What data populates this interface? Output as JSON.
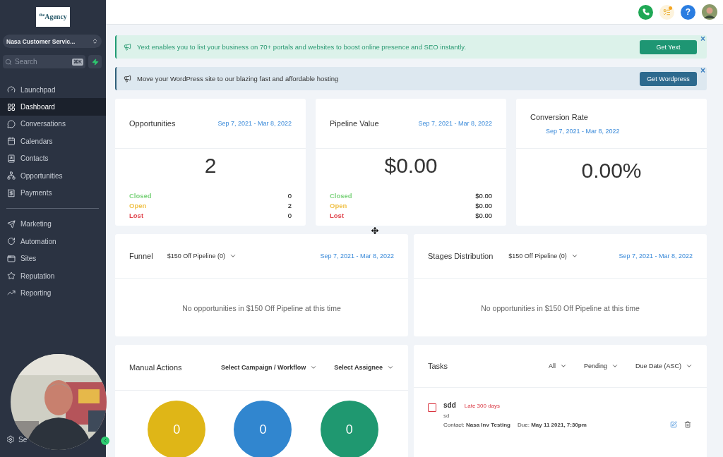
{
  "sidebar": {
    "logo": "$^{the}$Agency",
    "account": "Nasa Customer Servic...",
    "search": {
      "placeholder": "Search",
      "shortcut": "⌘K"
    },
    "nav_groups": [
      [
        {
          "label": "Launchpad",
          "selected": false
        },
        {
          "label": "Dashboard",
          "selected": true
        },
        {
          "label": "Conversations",
          "selected": false
        },
        {
          "label": "Calendars",
          "selected": false
        },
        {
          "label": "Contacts",
          "selected": false
        },
        {
          "label": "Opportunities",
          "selected": false
        },
        {
          "label": "Payments",
          "selected": false
        }
      ],
      [
        {
          "label": "Marketing",
          "selected": false
        },
        {
          "label": "Automation",
          "selected": false
        },
        {
          "label": "Sites",
          "selected": false
        },
        {
          "label": "Reputation",
          "selected": false
        },
        {
          "label": "Reporting",
          "selected": false
        }
      ]
    ],
    "settings": "Se"
  },
  "topbar": {
    "help": "?",
    "notification_dot": true
  },
  "banners": [
    {
      "kind": "success",
      "text": "Yext enables you to list your business on 70+ portals and websites to boost online presence and SEO instantly.",
      "button": "Get Yext",
      "close": "×"
    },
    {
      "kind": "info",
      "text": "Move your WordPress site to our blazing fast and affordable hosting",
      "button": "Get Wordpress",
      "close": "×"
    }
  ],
  "stat_cards": [
    {
      "title": "Opportunities",
      "date_range": "Sep 7, 2021 - Mar 8, 2022",
      "value": "2",
      "breakdown": [
        {
          "label": "Closed",
          "value": "0",
          "color": "#7ed37e"
        },
        {
          "label": "Open",
          "value": "2",
          "color": "#f0c24b"
        },
        {
          "label": "Lost",
          "value": "0",
          "color": "#e0474f"
        }
      ]
    },
    {
      "title": "Pipeline Value",
      "date_range": "Sep 7, 2021 - Mar 8, 2022",
      "value": "$0.00",
      "breakdown": [
        {
          "label": "Closed",
          "value": "$0.00",
          "color": "#7ed37e"
        },
        {
          "label": "Open",
          "value": "$0.00",
          "color": "#f0c24b"
        },
        {
          "label": "Lost",
          "value": "$0.00",
          "color": "#e0474f"
        }
      ]
    },
    {
      "title": "Conversion Rate",
      "date_range": "Sep 7, 2021 - Mar 8, 2022",
      "value": "0.00%"
    }
  ],
  "pipeline_cards": [
    {
      "title": "Funnel",
      "pipeline": "$150 Off Pipeline (0)",
      "date_range": "Sep 7, 2021 - Mar 8, 2022",
      "message": "No opportunities in $150 Off Pipeline at this time"
    },
    {
      "title": "Stages Distribution",
      "pipeline": "$150 Off Pipeline (0)",
      "date_range": "Sep 7, 2021 - Mar 8, 2022",
      "message": "No opportunities in $150 Off Pipeline at this time"
    }
  ],
  "manual_actions": {
    "title": "Manual Actions",
    "filters": [
      "Select Campaign / Workflow",
      "Select Assignee"
    ],
    "counters": [
      {
        "value": "0",
        "color": "#dfb617"
      },
      {
        "value": "0",
        "color": "#3186cf"
      },
      {
        "value": "0",
        "color": "#1f9870"
      }
    ]
  },
  "tasks": {
    "title": "Tasks",
    "filters": [
      "All",
      "Pending",
      "Due Date (ASC)"
    ],
    "items": [
      {
        "title": "sdd",
        "badge": "Late 300 days",
        "description": "sd",
        "checked": false,
        "contact": "Contact: **Nasa Inv Testing**",
        "due": "Due: **May 11 2021, 7:30pm**"
      }
    ]
  }
}
